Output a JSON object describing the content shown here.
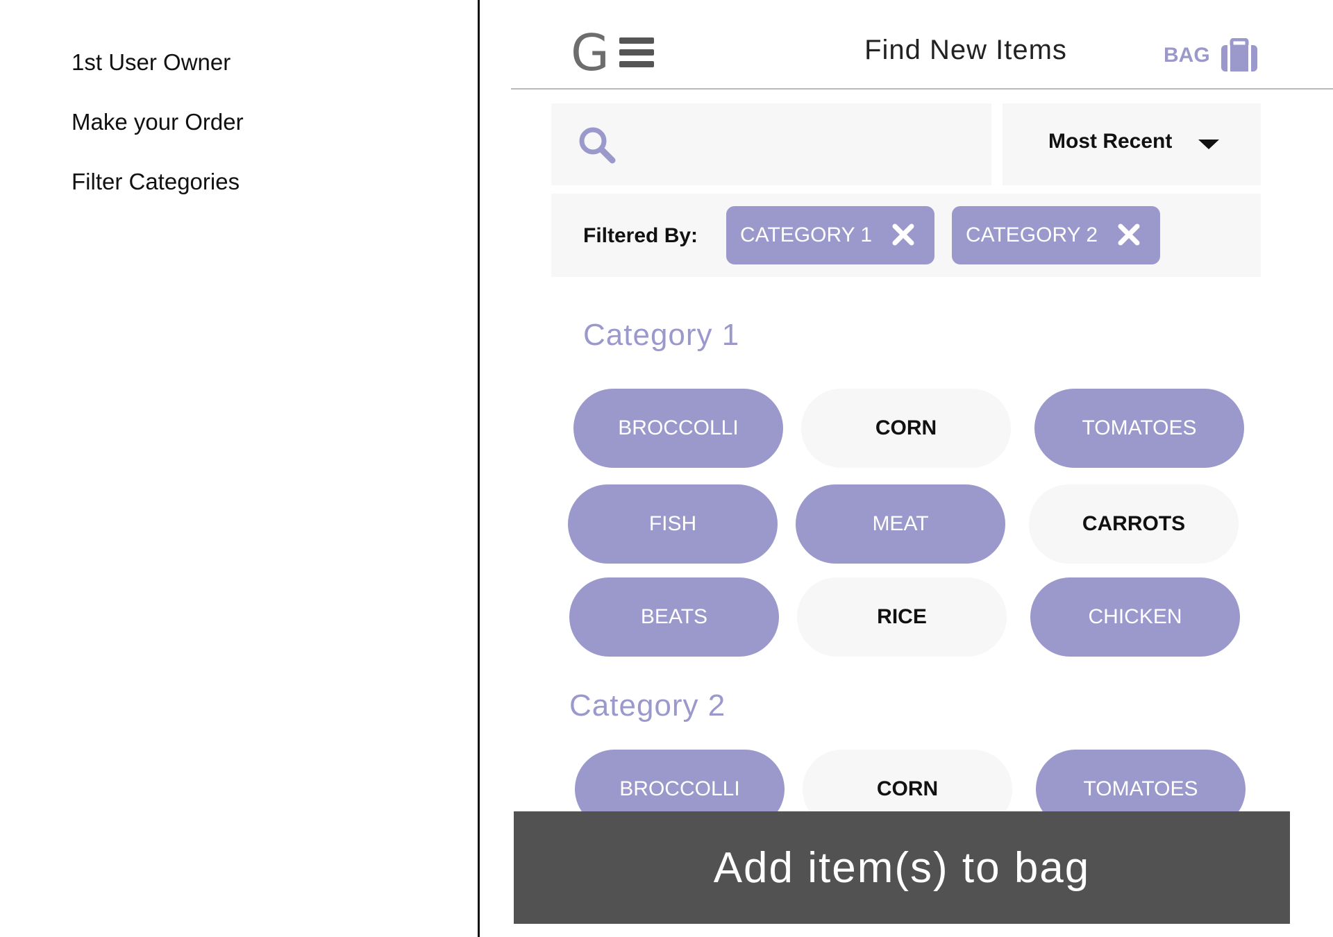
{
  "notes": [
    "1st User Owner",
    "Make your Order",
    "Filter Categories"
  ],
  "topbar": {
    "logo_letter": "G",
    "title": "Find New Items",
    "bag_label": "BAG"
  },
  "search": {
    "value": "",
    "placeholder": ""
  },
  "sort": {
    "selected": "Most Recent"
  },
  "filters": {
    "label": "Filtered By:",
    "chips": [
      "CATEGORY 1",
      "CATEGORY 2"
    ]
  },
  "categories": [
    {
      "title": "Category 1",
      "items": [
        {
          "label": "BROCCOLLI",
          "selected": true
        },
        {
          "label": "CORN",
          "selected": false
        },
        {
          "label": "TOMATOES",
          "selected": true
        },
        {
          "label": "FISH",
          "selected": true
        },
        {
          "label": "MEAT",
          "selected": true
        },
        {
          "label": "CARROTS",
          "selected": false
        },
        {
          "label": "BEATS",
          "selected": true
        },
        {
          "label": "RICE",
          "selected": false
        },
        {
          "label": "CHICKEN",
          "selected": true
        }
      ]
    },
    {
      "title": "Category 2",
      "items": [
        {
          "label": "BROCCOLLI",
          "selected": true
        },
        {
          "label": "CORN",
          "selected": false
        },
        {
          "label": "TOMATOES",
          "selected": true
        }
      ]
    }
  ],
  "cta": {
    "label": "Add item(s) to bag"
  },
  "colors": {
    "accent": "#9b98cc",
    "panel": "#f6f7f6",
    "cta": "#525252"
  }
}
